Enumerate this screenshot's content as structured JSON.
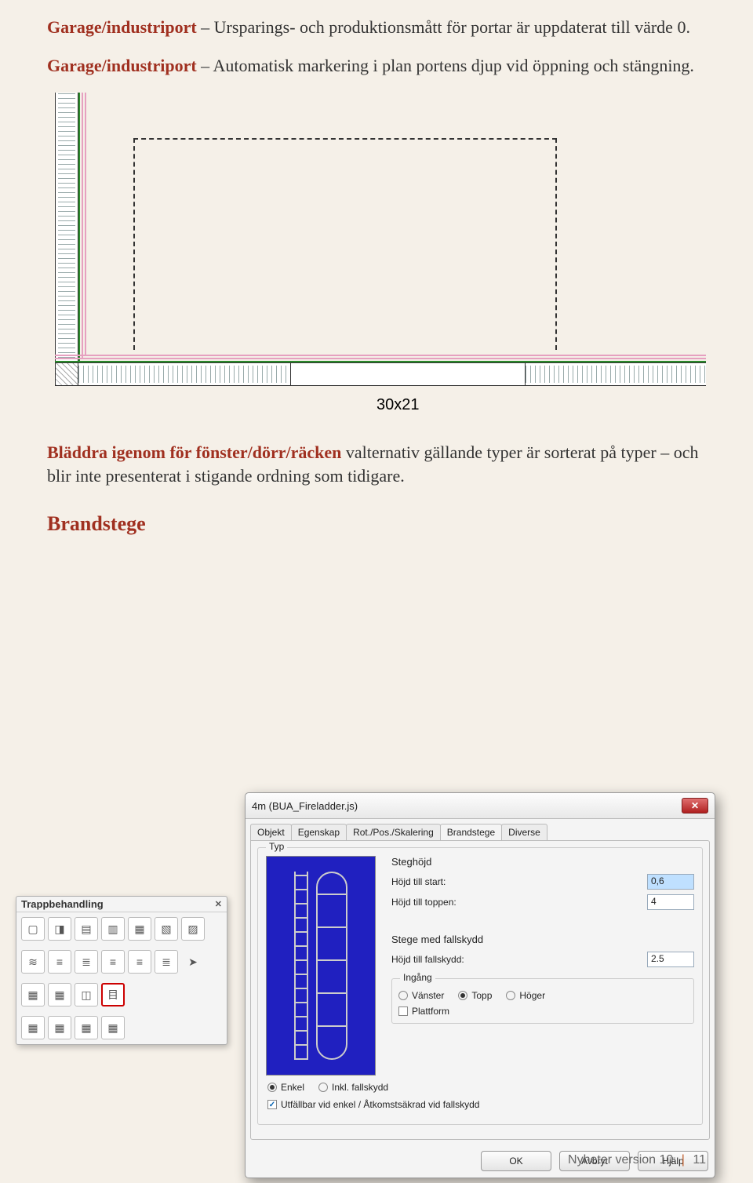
{
  "para1": {
    "lead": "Garage/industriport",
    "rest": " – Ursparings- och produktionsmått för portar är uppdaterat till värde 0."
  },
  "para2": {
    "lead": "Garage/industriport",
    "rest": " – Automatisk markering i plan portens djup vid öppning och stängning."
  },
  "plan": {
    "dim_label": "30x21"
  },
  "para3": {
    "lead": "Bläddra igenom för fönster/dörr/räcken",
    "rest": " valternativ gällande typer är sorterat på typer – och blir inte presenterat i stigande ordning som tidigare."
  },
  "heading": "Brandstege",
  "palette": {
    "title": "Trappbehandling"
  },
  "dialog": {
    "title": "4m (BUA_Fireladder.js)",
    "tabs": [
      "Objekt",
      "Egenskap",
      "Rot./Pos./Skalering",
      "Brandstege",
      "Diverse"
    ],
    "active_tab": 3,
    "typ_legend": "Typ",
    "steghojd_label": "Steghöjd",
    "hojd_start_label": "Höjd till start:",
    "hojd_start_value": "0,6",
    "hojd_topp_label": "Höjd till toppen:",
    "hojd_topp_value": "4",
    "fallskydd_section": "Stege med fallskydd",
    "hojd_fallskydd_label": "Höjd till fallskydd:",
    "hojd_fallskydd_value": "2.5",
    "ingang_legend": "Ingång",
    "ingang_vanster": "Vänster",
    "ingang_topp": "Topp",
    "ingang_hoger": "Höger",
    "plattform": "Plattform",
    "enkel": "Enkel",
    "inkl_fallskydd": "Inkl. fallskydd",
    "utfallbar": "Utfällbar vid enkel / Åtkomstsäkrad vid fallskydd",
    "ok": "OK",
    "avbryt": "Avbryt",
    "hjalp": "Hjälp"
  },
  "footer": {
    "text": "Nyheter version 10",
    "page": "11"
  }
}
